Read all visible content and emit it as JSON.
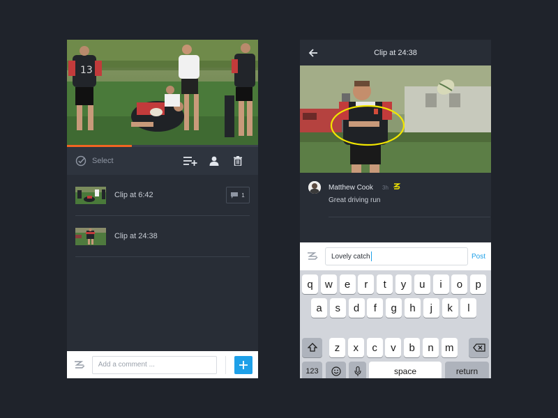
{
  "left_screen": {
    "video": {
      "progress_percent": 34
    },
    "toolbar": {
      "select_label": "Select",
      "icons": [
        "check-circle-icon",
        "add-to-playlist-icon",
        "person-icon",
        "trash-icon"
      ]
    },
    "clips": [
      {
        "title": "Clip at 6:42",
        "comment_count": "1"
      },
      {
        "title": "Clip at 24:38"
      }
    ],
    "composer": {
      "placeholder": "Add a comment ...",
      "add_icon": "plus-icon"
    }
  },
  "right_screen": {
    "header": {
      "title": "Clip at 24:38",
      "back_icon": "arrow-left-icon"
    },
    "comment": {
      "author": "Matthew Cook",
      "time": "3h",
      "text": "Great driving run"
    },
    "reply": {
      "value": "Lovely catch",
      "post_label": "Post"
    },
    "keyboard": {
      "row1": [
        "q",
        "w",
        "e",
        "r",
        "t",
        "y",
        "u",
        "i",
        "o",
        "p"
      ],
      "row2": [
        "a",
        "s",
        "d",
        "f",
        "g",
        "h",
        "j",
        "k",
        "l"
      ],
      "row3": [
        "z",
        "x",
        "c",
        "v",
        "b",
        "n",
        "m"
      ],
      "numbers_label": "123",
      "space_label": "space",
      "return_label": "return"
    }
  },
  "colors": {
    "background": "#1f232b",
    "panel": "#282d36",
    "accent_blue": "#1ea0e8",
    "progress_orange": "#f26522",
    "annotation_yellow": "#f2e600"
  }
}
